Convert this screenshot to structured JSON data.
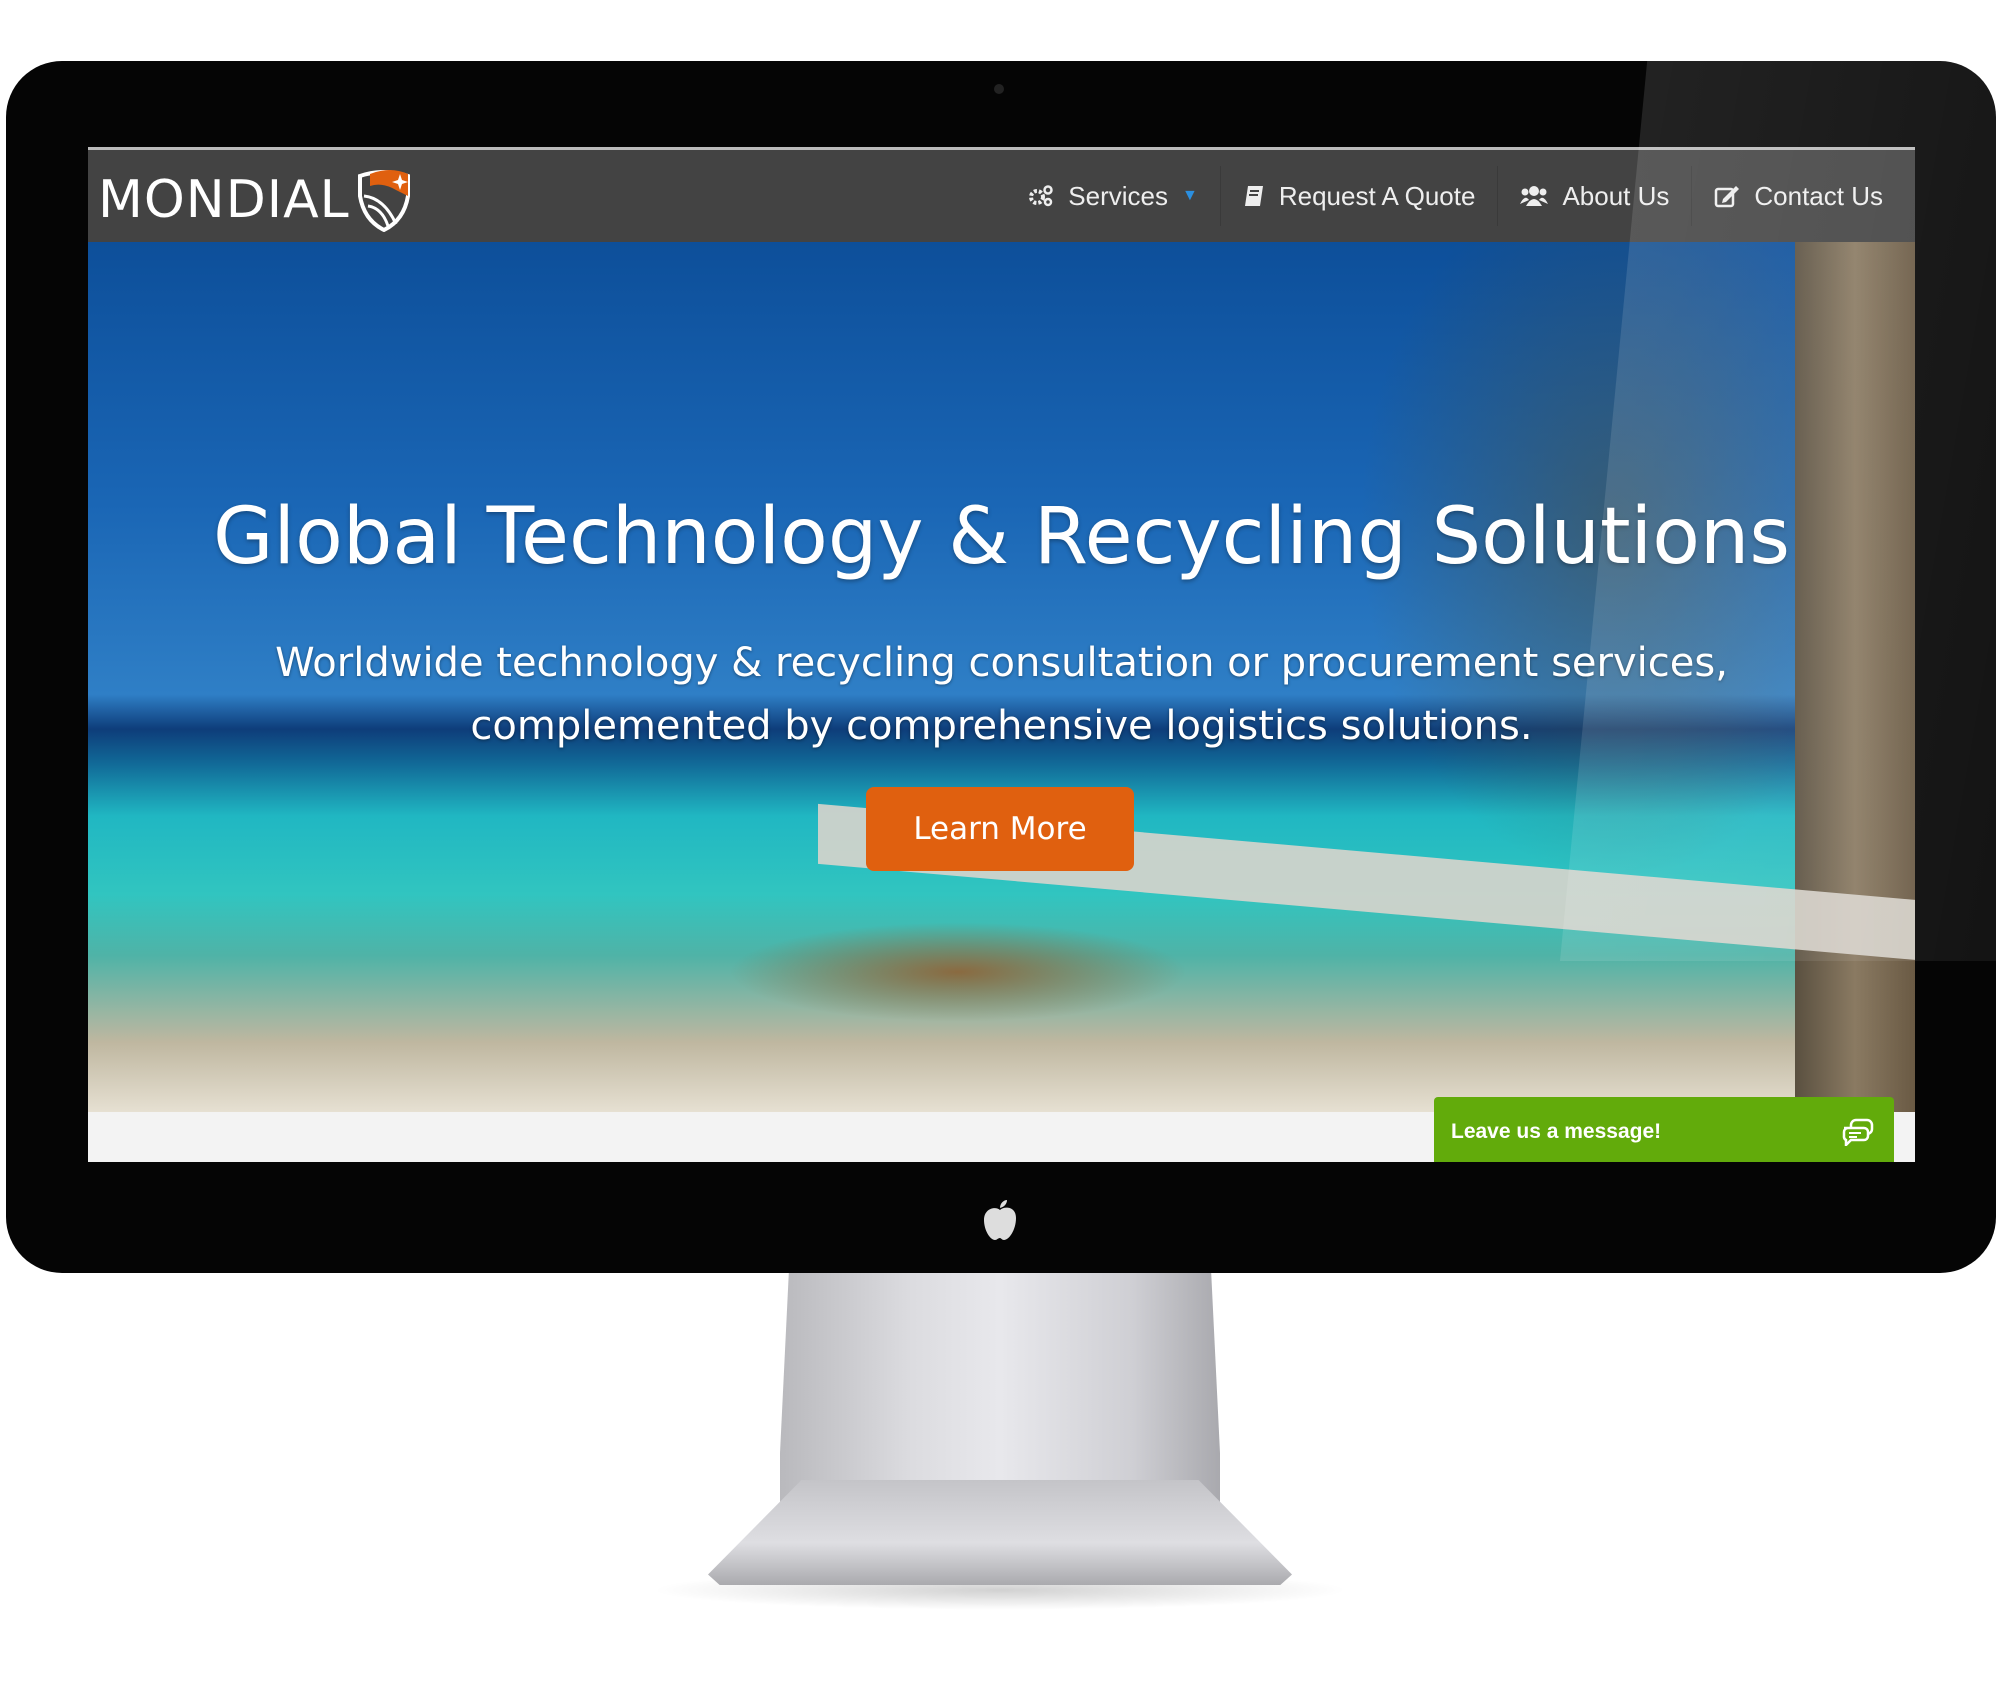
{
  "brand": {
    "name": "MONDIAL",
    "accent": "#e0600f"
  },
  "nav": {
    "items": [
      {
        "label": "Services",
        "icon": "gears-icon",
        "has_dropdown": true
      },
      {
        "label": "Request A Quote",
        "icon": "book-icon"
      },
      {
        "label": "About Us",
        "icon": "users-icon"
      },
      {
        "label": "Contact Us",
        "icon": "edit-icon"
      }
    ]
  },
  "hero": {
    "title": "Global Technology & Recycling Solutions",
    "subtitle": "Worldwide technology & recycling consultation or procurement services, complemented by comprehensive logistics solutions.",
    "cta": "Learn More"
  },
  "chat": {
    "label": "Leave us a message!",
    "icon": "chat-bubbles-icon",
    "color": "#62ab0b"
  }
}
